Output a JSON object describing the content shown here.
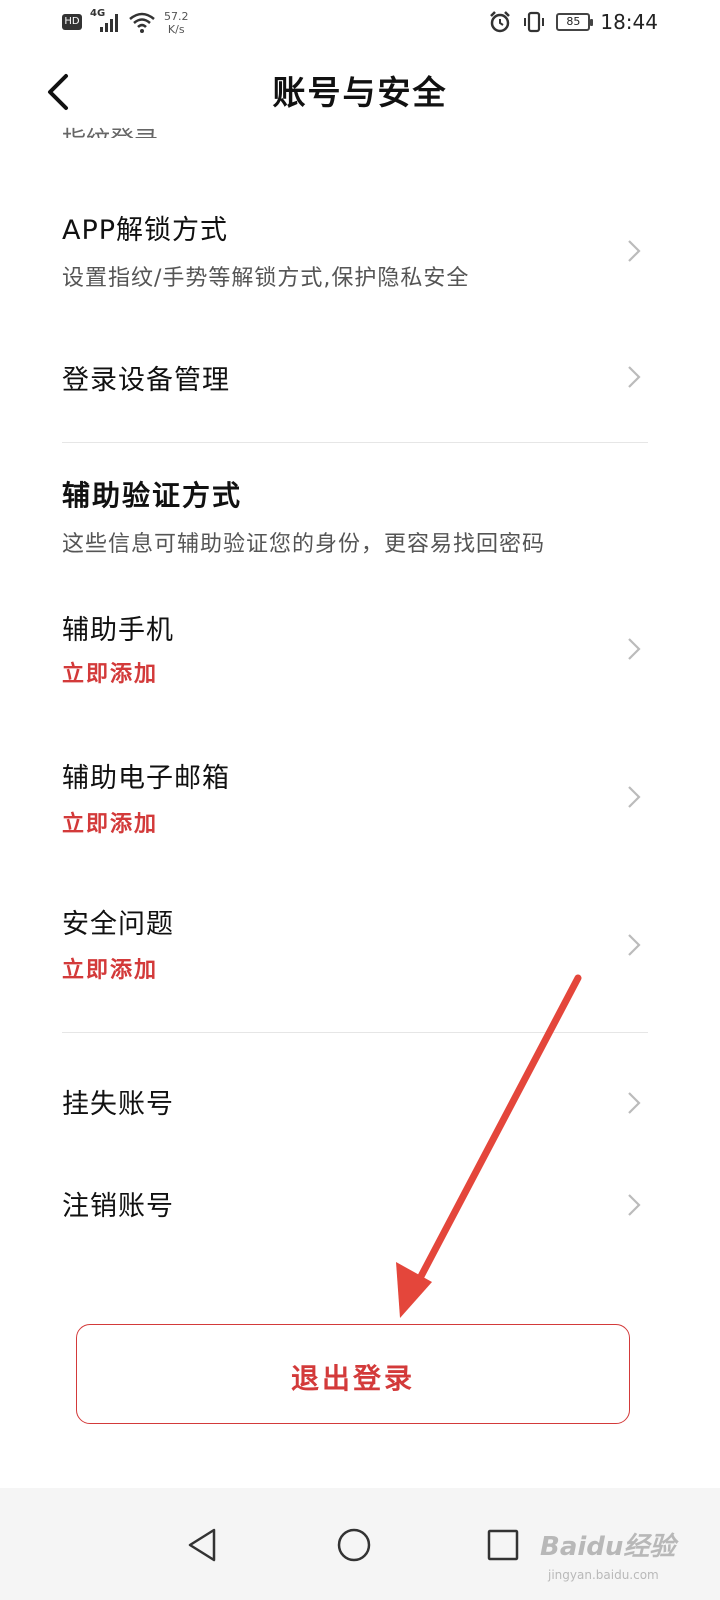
{
  "status_bar": {
    "hd": "HD",
    "network": "4G",
    "speed_value": "57.2",
    "speed_unit": "K/s",
    "battery": "85",
    "time": "18:44"
  },
  "header": {
    "title": "账号与安全"
  },
  "cut_off_item": "指纹登录",
  "rows": {
    "app_unlock": {
      "title": "APP解锁方式",
      "subtitle": "设置指纹/手势等解锁方式,保护隐私安全"
    },
    "device_mgmt": {
      "title": "登录设备管理"
    }
  },
  "aux_section": {
    "title": "辅助验证方式",
    "description": "这些信息可辅助验证您的身份，更容易找回密码"
  },
  "aux_rows": {
    "phone": {
      "title": "辅助手机",
      "action": "立即添加"
    },
    "email": {
      "title": "辅助电子邮箱",
      "action": "立即添加"
    },
    "question": {
      "title": "安全问题",
      "action": "立即添加"
    }
  },
  "account_rows": {
    "report_lost": {
      "title": "挂失账号"
    },
    "cancel": {
      "title": "注销账号"
    }
  },
  "logout": {
    "label": "退出登录"
  },
  "watermark": {
    "brand": "Baidu经验",
    "url": "jingyan.baidu.com"
  },
  "colors": {
    "accent_red": "#d33a3a",
    "arrow_red": "#e4463b"
  },
  "icons": {
    "back": "chevron-left-icon",
    "row_arrow": "chevron-right-icon",
    "nav_back": "triangle-back-icon",
    "nav_home": "circle-home-icon",
    "nav_recent": "square-recent-icon"
  }
}
